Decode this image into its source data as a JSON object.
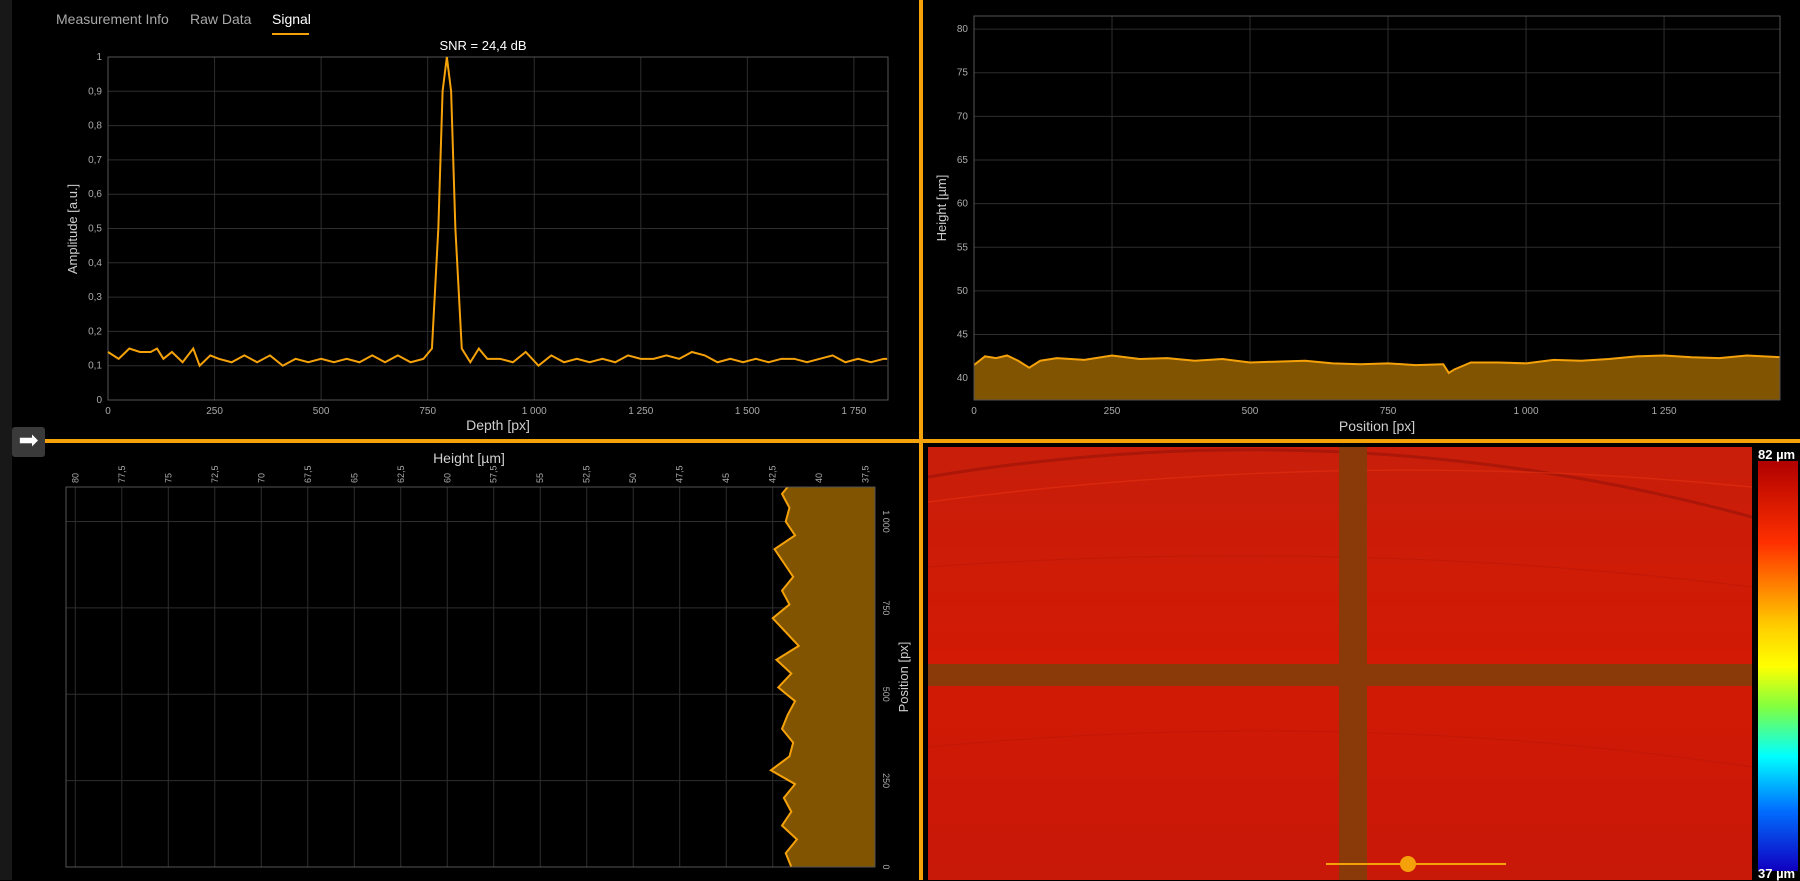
{
  "tabs": [
    {
      "label": "Measurement Info",
      "active": false
    },
    {
      "label": "Raw Data",
      "active": false
    },
    {
      "label": "Signal",
      "active": true
    }
  ],
  "accent_color": "#f5a20a",
  "expand_button": {
    "icon": "arrow-right-icon",
    "glyph": "➡"
  },
  "colorbar": {
    "max_label": "82 µm",
    "min_label": "37 µm"
  },
  "chart_data": [
    {
      "type": "line",
      "title": "SNR = 24,4 dB",
      "xlabel": "Depth [px]",
      "ylabel": "Amplitude [a.u.]",
      "xlim": [
        0,
        1830
      ],
      "ylim": [
        0,
        1
      ],
      "x_ticks": [
        0,
        250,
        500,
        750,
        1000,
        1250,
        1500,
        1750
      ],
      "x_tick_labels": [
        "0",
        "250",
        "500",
        "750",
        "1 000",
        "1 250",
        "1 500",
        "1 750"
      ],
      "y_ticks": [
        0,
        0.1,
        0.2,
        0.3,
        0.4,
        0.5,
        0.6,
        0.7,
        0.8,
        0.9,
        1
      ],
      "y_tick_labels": [
        "0",
        "0,1",
        "0,2",
        "0,3",
        "0,4",
        "0,5",
        "0,6",
        "0,7",
        "0,8",
        "0,9",
        "1"
      ],
      "grid": true,
      "series": [
        {
          "x": [
            0,
            25,
            50,
            75,
            100,
            115,
            130,
            150,
            175,
            200,
            215,
            240,
            260,
            290,
            320,
            350,
            380,
            410,
            440,
            470,
            500,
            530,
            560,
            590,
            620,
            650,
            680,
            710,
            740,
            760,
            775,
            785,
            795,
            805,
            815,
            830,
            850,
            870,
            890,
            920,
            950,
            980,
            1010,
            1040,
            1070,
            1100,
            1130,
            1160,
            1190,
            1220,
            1250,
            1280,
            1310,
            1340,
            1370,
            1400,
            1430,
            1460,
            1490,
            1520,
            1550,
            1580,
            1610,
            1640,
            1670,
            1700,
            1730,
            1760,
            1790,
            1820,
            1828
          ],
          "y": [
            0.14,
            0.12,
            0.15,
            0.14,
            0.14,
            0.15,
            0.12,
            0.14,
            0.11,
            0.15,
            0.1,
            0.13,
            0.12,
            0.11,
            0.13,
            0.11,
            0.13,
            0.1,
            0.12,
            0.11,
            0.12,
            0.11,
            0.12,
            0.11,
            0.13,
            0.11,
            0.13,
            0.11,
            0.12,
            0.15,
            0.5,
            0.9,
            1.0,
            0.9,
            0.5,
            0.15,
            0.11,
            0.15,
            0.12,
            0.12,
            0.11,
            0.14,
            0.1,
            0.13,
            0.11,
            0.12,
            0.11,
            0.12,
            0.11,
            0.13,
            0.12,
            0.12,
            0.13,
            0.12,
            0.14,
            0.13,
            0.11,
            0.12,
            0.11,
            0.12,
            0.11,
            0.12,
            0.12,
            0.11,
            0.12,
            0.13,
            0.11,
            0.12,
            0.11,
            0.12,
            0.12
          ]
        }
      ]
    },
    {
      "type": "area",
      "xlabel": "Position [px]",
      "ylabel": "Height [µm]",
      "xlim": [
        0,
        1460
      ],
      "ylim": [
        37.5,
        81.5
      ],
      "x_ticks": [
        0,
        250,
        500,
        750,
        1000,
        1250
      ],
      "x_tick_labels": [
        "0",
        "250",
        "500",
        "750",
        "1 000",
        "1 250"
      ],
      "y_ticks": [
        40,
        45,
        50,
        55,
        60,
        65,
        70,
        75,
        80
      ],
      "y_tick_labels": [
        "40",
        "45",
        "50",
        "55",
        "60",
        "65",
        "70",
        "75",
        "80"
      ],
      "grid": true,
      "series": [
        {
          "x": [
            0,
            20,
            40,
            60,
            80,
            100,
            120,
            150,
            200,
            250,
            300,
            350,
            400,
            450,
            500,
            550,
            600,
            650,
            700,
            650,
            700,
            750,
            800,
            850,
            860,
            870,
            900,
            950,
            1000,
            1050,
            1100,
            1150,
            1200,
            1250,
            1300,
            1350,
            1400,
            1460
          ],
          "y": [
            41.5,
            42.5,
            42.3,
            42.6,
            42.0,
            41.2,
            42.0,
            42.3,
            42.1,
            42.6,
            42.2,
            42.3,
            42.0,
            42.2,
            41.8,
            41.9,
            42.0,
            41.7,
            41.6,
            41.7,
            41.6,
            41.7,
            41.5,
            41.6,
            40.6,
            41.0,
            41.8,
            41.8,
            41.7,
            42.1,
            42.0,
            42.2,
            42.5,
            42.6,
            42.4,
            42.3,
            42.6,
            42.4
          ]
        }
      ]
    },
    {
      "type": "area",
      "orientation": "vertical",
      "xlabel": "Height [µm]",
      "ylabel": "Position [px]",
      "xlim": [
        80.5,
        37
      ],
      "ylim": [
        0,
        1100
      ],
      "x_ticks": [
        80,
        77.5,
        75,
        72.5,
        70,
        67.5,
        65,
        62.5,
        60,
        57.5,
        55,
        52.5,
        50,
        47.5,
        45,
        42.5,
        40,
        37.5
      ],
      "x_tick_labels": [
        "80",
        "77,5",
        "75",
        "72,5",
        "70",
        "67,5",
        "65",
        "62,5",
        "60",
        "57,5",
        "55",
        "52,5",
        "50",
        "47,5",
        "45",
        "42,5",
        "40",
        "37,5"
      ],
      "y_ticks": [
        0,
        250,
        500,
        750,
        1000
      ],
      "y_tick_labels": [
        "0",
        "250",
        "500",
        "750",
        "1 000"
      ],
      "grid": true,
      "series": [
        {
          "y": [
            0,
            40,
            80,
            120,
            160,
            200,
            240,
            280,
            320,
            360,
            400,
            440,
            480,
            520,
            560,
            600,
            640,
            680,
            720,
            760,
            800,
            840,
            880,
            920,
            960,
            1000,
            1040,
            1080,
            1100
          ],
          "x": [
            41.5,
            41.8,
            41.2,
            42.0,
            41.5,
            41.9,
            41.3,
            42.6,
            41.6,
            41.4,
            42.0,
            41.7,
            41.3,
            42.2,
            41.5,
            42.3,
            41.1,
            41.8,
            42.5,
            41.6,
            42.0,
            41.4,
            41.9,
            42.4,
            41.3,
            41.8,
            41.6,
            42.0,
            41.7
          ]
        }
      ]
    }
  ]
}
